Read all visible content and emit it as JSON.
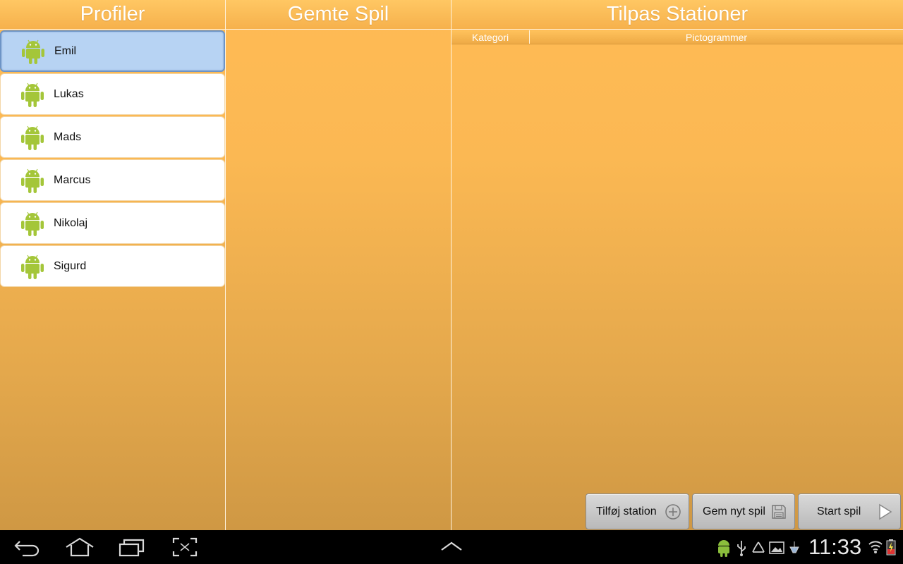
{
  "columns": {
    "profiles_title": "Profiler",
    "saved_games_title": "Gemte Spil",
    "stations_title": "Tilpas Stationer"
  },
  "profiles": [
    {
      "name": "Emil",
      "selected": true
    },
    {
      "name": "Lukas",
      "selected": false
    },
    {
      "name": "Mads",
      "selected": false
    },
    {
      "name": "Marcus",
      "selected": false
    },
    {
      "name": "Nikolaj",
      "selected": false
    },
    {
      "name": "Sigurd",
      "selected": false
    }
  ],
  "stations_table": {
    "category_header": "Kategori",
    "pictograms_header": "Pictogrammer"
  },
  "actions": {
    "add_station": "Tilføj station",
    "save_new_game": "Gem nyt spil",
    "start_game": "Start spil"
  },
  "status_bar": {
    "time": "11:33"
  },
  "colors": {
    "accent_orange": "#ffbb55",
    "android_green": "#a4c639",
    "selected_blue": "#b7d3f3"
  }
}
